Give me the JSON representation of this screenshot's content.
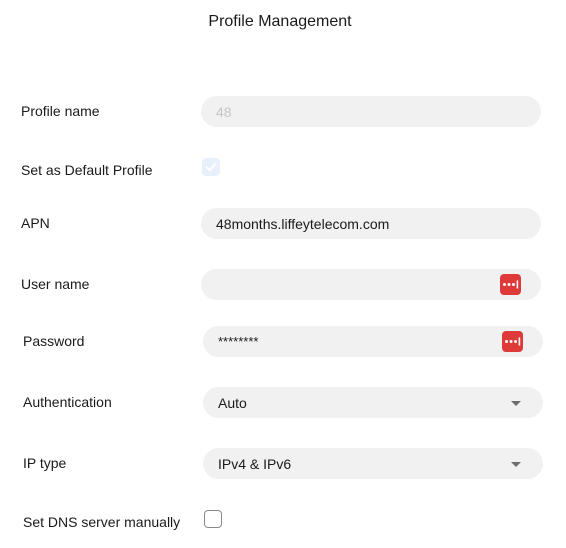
{
  "header": {
    "title": "Profile Management"
  },
  "colors": {
    "field_bg": "#f1f1f1",
    "key_button": "#de3a3a",
    "checkbox_disabled": "#e8f1fb"
  },
  "form": {
    "profile_name": {
      "label": "Profile name",
      "value": "48"
    },
    "default_profile": {
      "label": "Set as Default Profile",
      "checked": true
    },
    "apn": {
      "label": "APN",
      "value": "48months.liffeytelecom.com"
    },
    "user_name": {
      "label": "User name",
      "value": "",
      "icon": "password-key-icon"
    },
    "password": {
      "label": "Password",
      "value": "********",
      "icon": "password-key-icon"
    },
    "authentication": {
      "label": "Authentication",
      "selected": "Auto"
    },
    "ip_type": {
      "label": "IP type",
      "selected": "IPv4 & IPv6"
    },
    "dns_manual": {
      "label": "Set DNS server manually",
      "checked": false
    }
  }
}
